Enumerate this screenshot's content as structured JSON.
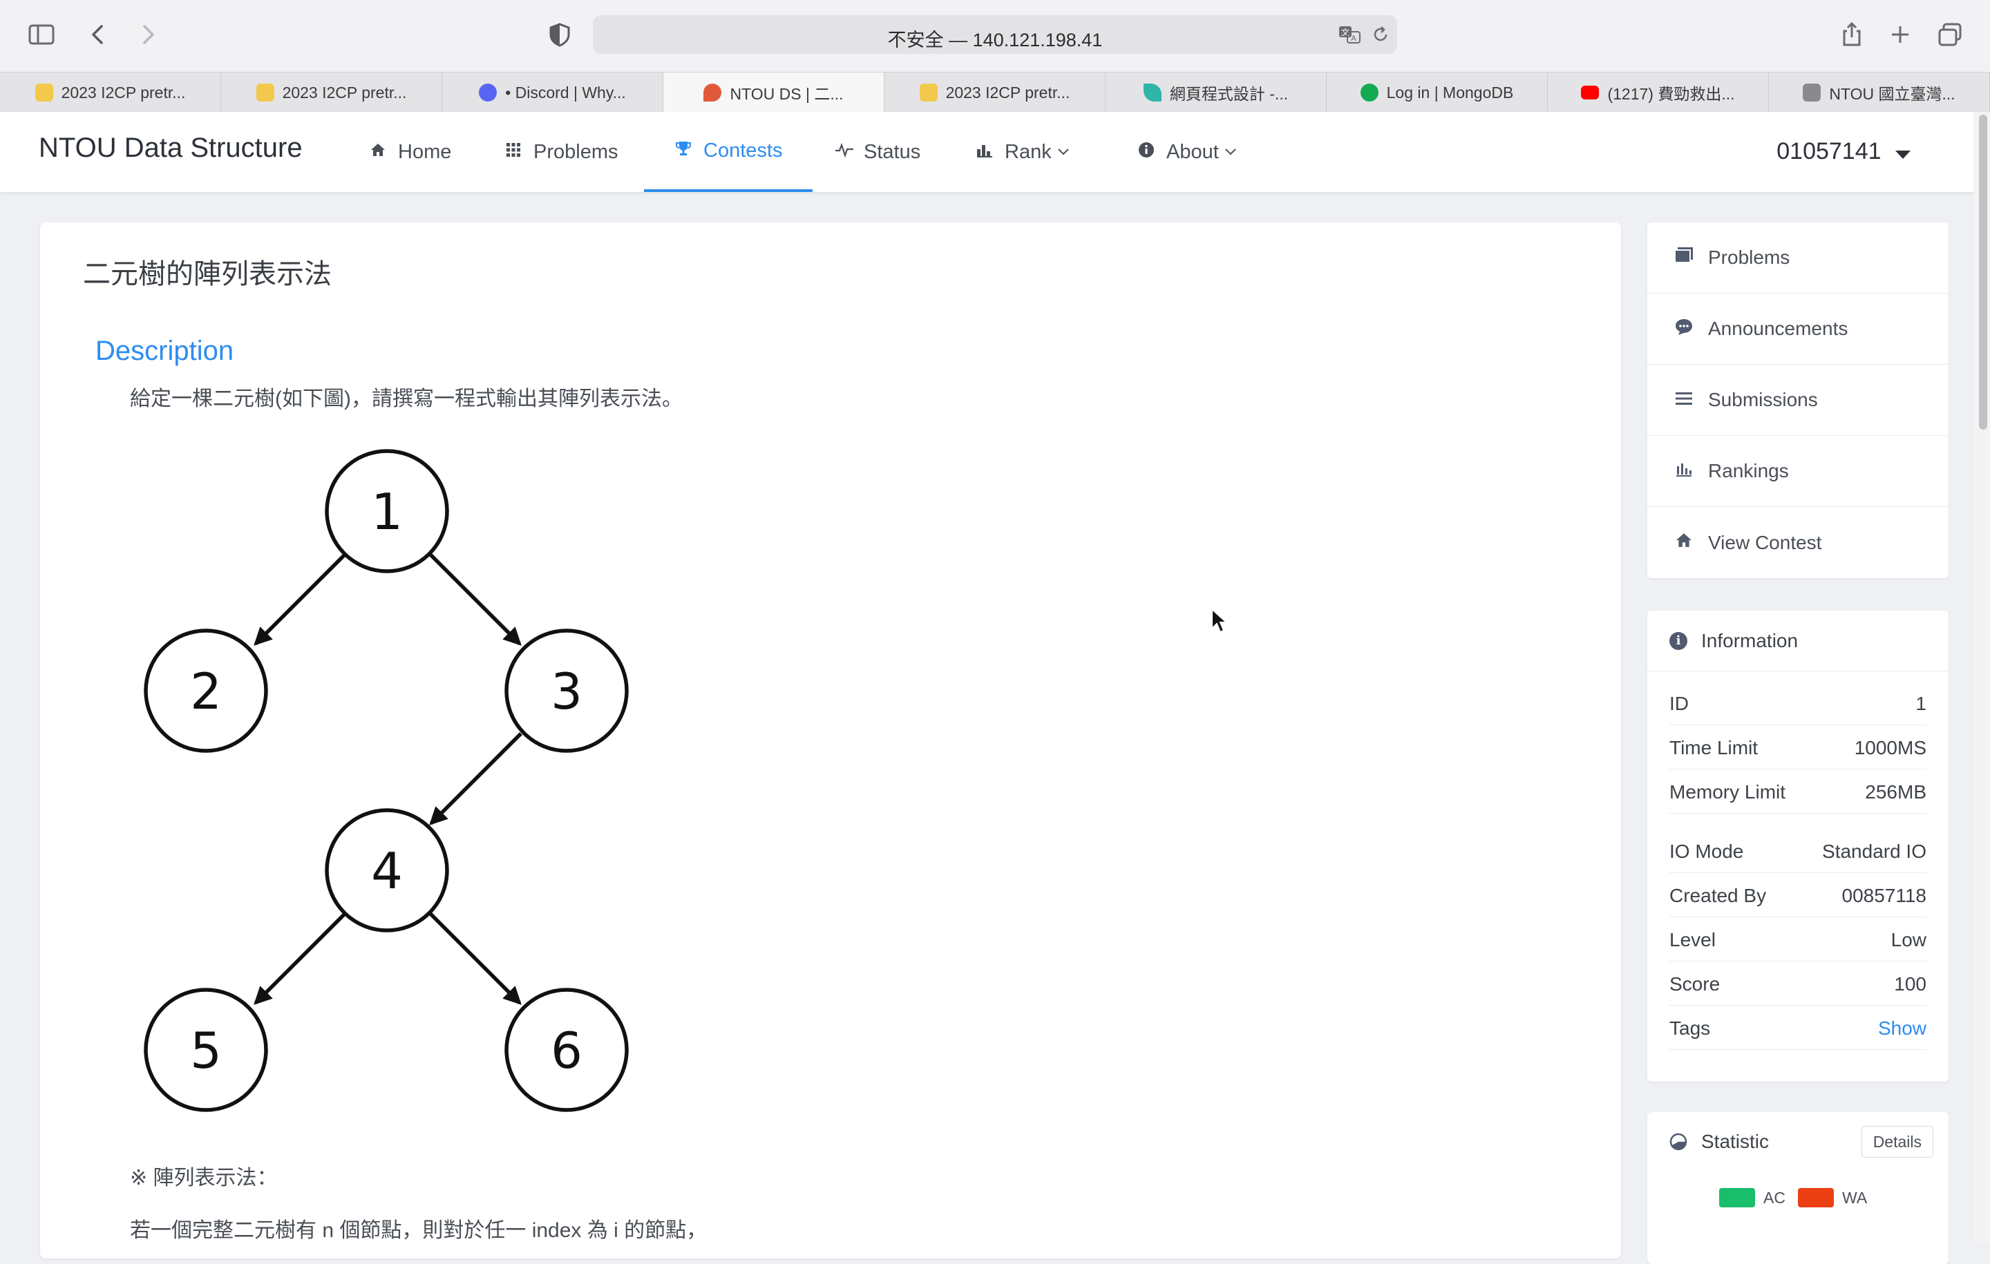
{
  "browser": {
    "url": "不安全 — 140.121.198.41",
    "tabs": [
      {
        "label": "2023 I2CP pretr...",
        "favicon": "smiley-icon",
        "color": "#f2c94c"
      },
      {
        "label": "2023 I2CP pretr...",
        "favicon": "smiley-icon",
        "color": "#f2c94c"
      },
      {
        "label": "• Discord | Why...",
        "favicon": "discord-icon",
        "color": "#5865f2"
      },
      {
        "label": "NTOU DS | 二...",
        "favicon": "balloon-icon",
        "color": "#e05a3a"
      },
      {
        "label": "2023 I2CP pretr...",
        "favicon": "smiley-icon",
        "color": "#f2c94c"
      },
      {
        "label": "網頁程式設計 -...",
        "favicon": "leaf-icon",
        "color": "#2fb5a8"
      },
      {
        "label": "Log in | MongoDB",
        "favicon": "mongodb-icon",
        "color": "#13aa52"
      },
      {
        "label": "(1217) 費勁救出...",
        "favicon": "youtube-icon",
        "color": "#ff0000"
      },
      {
        "label": "NTOU 國立臺灣...",
        "favicon": "notion-icon",
        "color": "#8a8a8e"
      }
    ],
    "active_tab": 3
  },
  "header": {
    "brand": "NTOU Data Structure",
    "nav": [
      {
        "label": "Home",
        "icon": "home-icon"
      },
      {
        "label": "Problems",
        "icon": "grid-icon"
      },
      {
        "label": "Contests",
        "icon": "trophy-icon"
      },
      {
        "label": "Status",
        "icon": "pulse-icon"
      },
      {
        "label": "Rank",
        "icon": "bar-chart-icon"
      },
      {
        "label": "About",
        "icon": "info-icon"
      }
    ],
    "active_nav": "Contests",
    "user": "01057141"
  },
  "problem": {
    "title": "二元樹的陣列表示法",
    "section": "Description",
    "description": "給定一棵二元樹(如下圖)，請撰寫一程式輸出其陣列表示法。",
    "tree_nodes": [
      "1",
      "2",
      "3",
      "4",
      "5",
      "6"
    ],
    "note_heading": "※ 陣列表示法：",
    "note_text": "若一個完整二元樹有 n 個節點，則對於任一 index 為 i 的節點，"
  },
  "sidebar": {
    "menu": [
      {
        "label": "Problems",
        "icon": "problems-icon"
      },
      {
        "label": "Announcements",
        "icon": "chat-bubble-icon"
      },
      {
        "label": "Submissions",
        "icon": "list-icon"
      },
      {
        "label": "Rankings",
        "icon": "bar-chart-icon"
      },
      {
        "label": "View Contest",
        "icon": "home-icon"
      }
    ],
    "information": {
      "title": "Information",
      "rows": [
        {
          "label": "ID",
          "value": "1"
        },
        {
          "label": "Time Limit",
          "value": "1000MS"
        },
        {
          "label": "Memory Limit",
          "value": "256MB"
        },
        {
          "label": "IO Mode",
          "value": "Standard IO"
        },
        {
          "label": "Created By",
          "value": "00857118"
        },
        {
          "label": "Level",
          "value": "Low"
        },
        {
          "label": "Score",
          "value": "100"
        },
        {
          "label": "Tags",
          "value": "Show"
        }
      ]
    },
    "statistic": {
      "title": "Statistic",
      "details_label": "Details",
      "legend": [
        {
          "label": "AC",
          "color": "#19be6b"
        },
        {
          "label": "WA",
          "color": "#ed3f14"
        }
      ]
    }
  }
}
